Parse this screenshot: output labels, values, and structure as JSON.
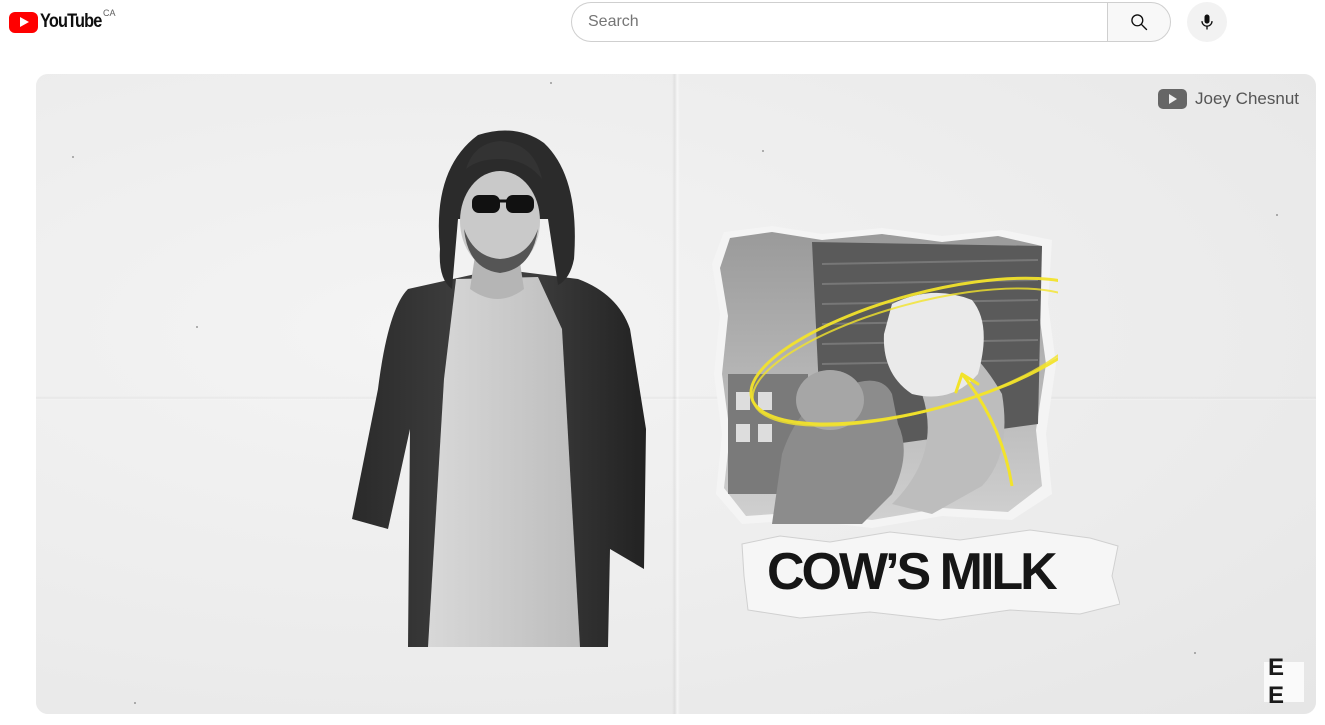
{
  "header": {
    "logo_text": "YouTube",
    "country_code": "CA",
    "search_placeholder": "Search"
  },
  "video": {
    "channel_watermark": "Joey Chesnut",
    "overlay_title": "COW’S MILK",
    "corner_logo": "E E"
  },
  "icons": {
    "logo": "youtube-logo-icon",
    "search": "search-icon",
    "mic": "microphone-icon",
    "channel": "youtube-play-icon"
  },
  "colors": {
    "brand_red": "#ff0000",
    "highlight_yellow": "#f2e32b"
  }
}
